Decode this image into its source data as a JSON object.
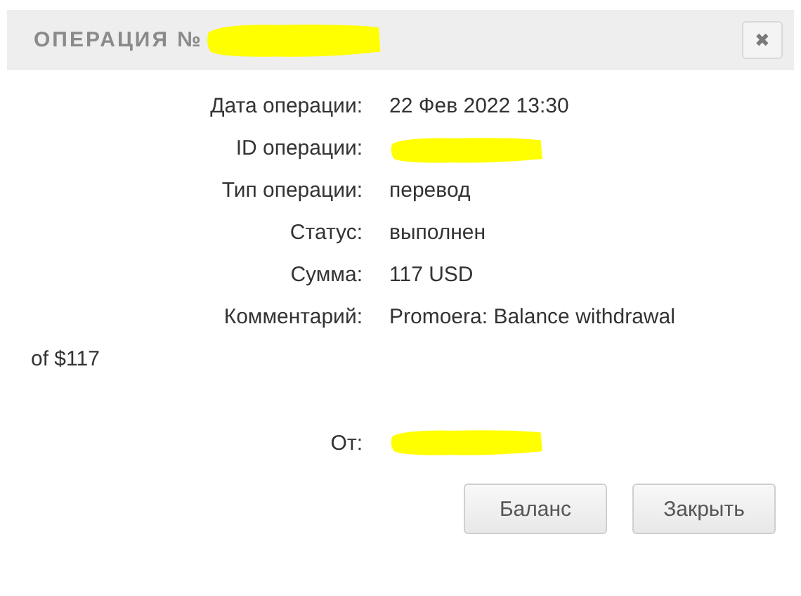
{
  "dialog": {
    "title": "ОПЕРАЦИЯ №",
    "title_redacted": true,
    "close_label": "✖"
  },
  "fields": [
    {
      "label": "Дата операции:",
      "kind": "text",
      "value": "22 Фев 2022 13:30"
    },
    {
      "label": "ID операции:",
      "kind": "redacted"
    },
    {
      "label": "Тип операции:",
      "kind": "text",
      "value": "перевод"
    },
    {
      "label": "Статус:",
      "kind": "text",
      "value": "выполнен"
    },
    {
      "label": "Сумма:",
      "kind": "text",
      "value": "117 USD"
    }
  ],
  "comment": {
    "label": "Комментарий:",
    "value_lines": [
      "Promoera: Balance withdrawal",
      "of $117"
    ]
  },
  "from": {
    "label": "От:",
    "kind": "redacted"
  },
  "buttons": [
    "Баланс",
    "Закрыть"
  ]
}
